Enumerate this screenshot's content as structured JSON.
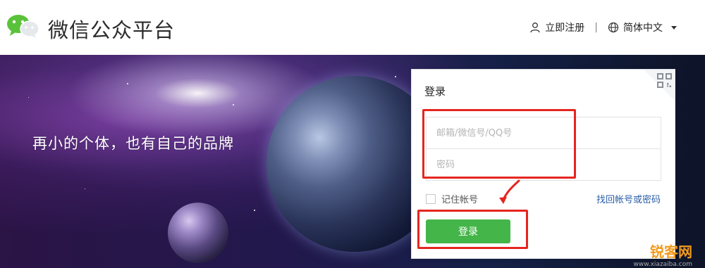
{
  "header": {
    "logo_text": "微信公众平台",
    "nav": {
      "register_label": "立即注册",
      "separator": "|",
      "language_label": "简体中文"
    }
  },
  "banner": {
    "tagline": "再小的个体，也有自己的品牌"
  },
  "login": {
    "title": "登录",
    "account_placeholder": "邮箱/微信号/QQ号",
    "password_placeholder": "密码",
    "remember_label": "记住帐号",
    "forgot_label": "找回帐号或密码",
    "submit_label": "登录"
  },
  "watermark": {
    "brand": "锐客网",
    "url": "www.xiazaiba.com"
  },
  "colors": {
    "brand_green": "#44b549",
    "link_blue": "#2a5ea8",
    "annotation_red": "#e5261f",
    "watermark_orange": "#f29b1f"
  }
}
